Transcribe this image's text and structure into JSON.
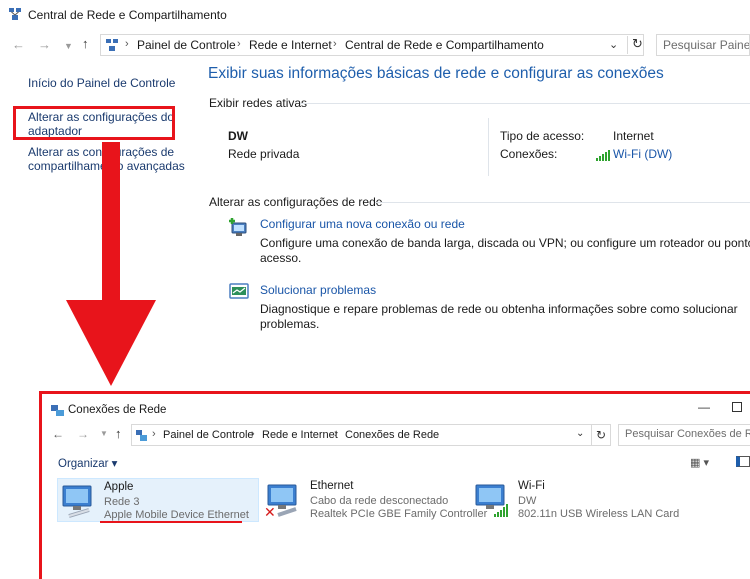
{
  "main_window": {
    "title": "Central de Rede e Compartilhamento",
    "breadcrumb": [
      "Painel de Controle",
      "Rede e Internet",
      "Central de Rede e Compartilhamento"
    ],
    "search_placeholder": "Pesquisar Painel d",
    "sidebar": {
      "home": "Início do Painel de Controle",
      "adapter_line1": "Alterar as configurações do",
      "adapter_line2": "adaptador",
      "advanced_line1": "Alterar as configurações de",
      "advanced_line2": "compartilhamento avançadas"
    },
    "heading": "Exibir suas informações básicas de rede e configurar as conexões",
    "active_networks_label": "Exibir redes ativas",
    "network": {
      "name": "DW",
      "type": "Rede privada",
      "access_type_label": "Tipo de acesso:",
      "access_type_value": "Internet",
      "connections_label": "Conexões:",
      "connections_value": "Wi-Fi (DW)"
    },
    "change_settings_label": "Alterar as configurações de rede",
    "tasks": [
      {
        "title": "Configurar uma nova conexão ou rede",
        "desc_line1": "Configure uma conexão de banda larga, discada ou VPN; ou configure um roteador ou ponto de",
        "desc_line2": "acesso."
      },
      {
        "title": "Solucionar problemas",
        "desc_line1": "Diagnostique e repare problemas de rede ou obtenha informações sobre como solucionar",
        "desc_line2": "problemas."
      }
    ]
  },
  "adapter_window": {
    "title": "Conexões de Rede",
    "breadcrumb": [
      "Painel de Controle",
      "Rede e Internet",
      "Conexões de Rede"
    ],
    "search_placeholder": "Pesquisar Conexões de Rede",
    "organize_label": "Organizar ▾",
    "adapters": [
      {
        "name": "Apple",
        "status": "Rede  3",
        "device": "Apple Mobile Device Ethernet"
      },
      {
        "name": "Ethernet",
        "status": "Cabo da rede desconectado",
        "device": "Realtek PCIe GBE Family Controller"
      },
      {
        "name": "Wi-Fi",
        "status": "DW",
        "device": "802.11n USB Wireless LAN Card"
      }
    ]
  },
  "colors": {
    "accent_blue": "#1e5eac",
    "link_blue": "#1a56a8",
    "annotation_red": "#e8141b",
    "wifi_green": "#2fa32f"
  },
  "icons": {
    "app": "network-center-icon",
    "back": "back-arrow-icon",
    "forward": "forward-arrow-icon",
    "up": "up-arrow-icon",
    "refresh": "refresh-icon",
    "wifi_signal": "wifi-signal-icon",
    "new_connection": "new-connection-icon",
    "troubleshoot": "troubleshoot-icon",
    "adapter": "network-adapter-icon"
  }
}
